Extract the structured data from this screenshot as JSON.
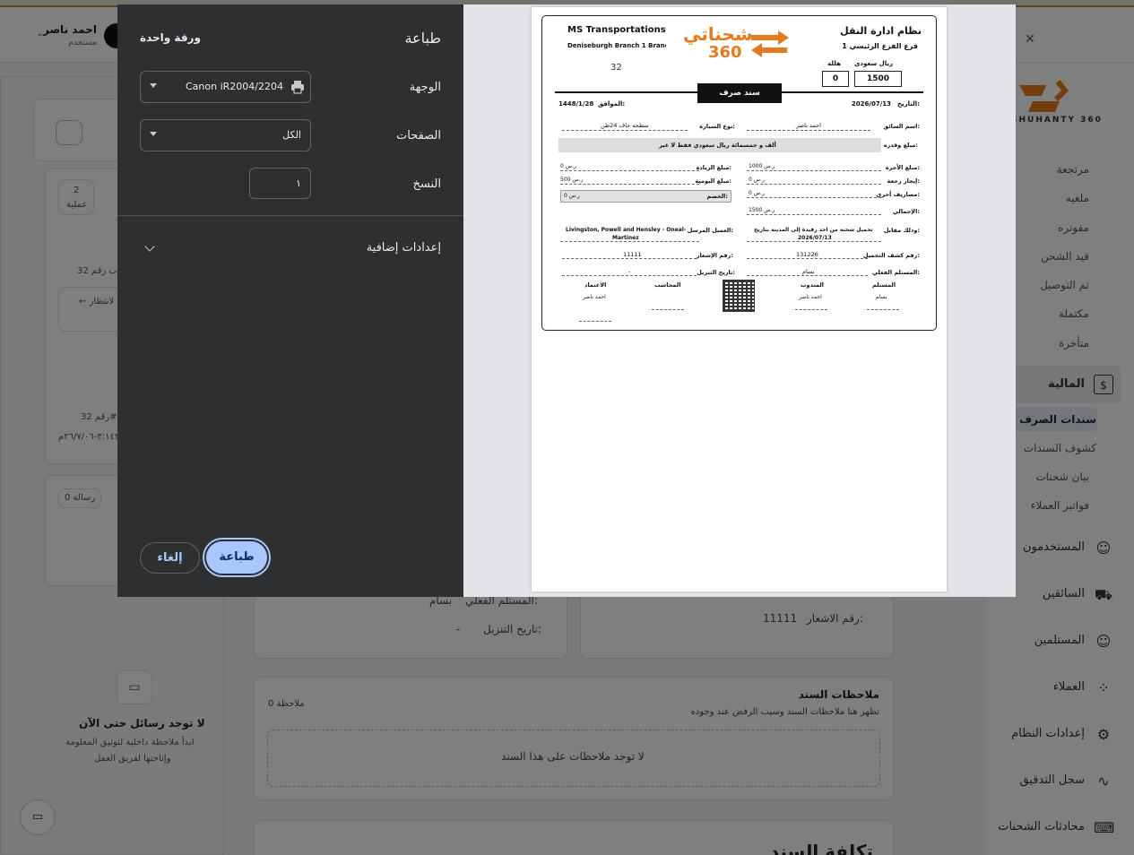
{
  "background": {
    "user": {
      "name": "احمد ناصر",
      "role": "مستخدم"
    },
    "sidebar": {
      "sub_items": [
        "مرتجعة",
        "ملغيه",
        "مفوتره",
        "قيد الشحن",
        "تم التوصيل",
        "مكتملة",
        "متأخرة"
      ],
      "finance_label": "المالية",
      "finance_sub": [
        "سندات الصرف",
        "كشوف السندات",
        "بيان شحنات",
        "فواتير العملاء"
      ],
      "main_items": [
        "المستخدمون",
        "السائقين",
        "المستلمين",
        "العملاء",
        "إعدادات النظام",
        "سجل التدقيق",
        "محادثات الشحنات"
      ],
      "logo_text": "SHUHANTY 360"
    },
    "left": {
      "count_value": "2",
      "count_label": "عملية",
      "doc_ref_1": "ب رقم 32#",
      "waiting": "← لانتظار",
      "doc_ref_2": "رقم 32#",
      "doc_date": "٣:١٤٢٨-٢٦/٧/٠٦م",
      "messages_badge": "0 رسالة",
      "no_messages_title": "لا توجد رسائل حتى الآن",
      "no_messages_desc_1": "ابدأ ملاحظة داخلية لتوثيق المعلومة",
      "no_messages_desc_2": "وإتاحتها لفريق العمل"
    },
    "main": {
      "actual_receiver_label": "المستلم الفعلي:",
      "actual_receiver_value": "بسام",
      "unload_date_label": "تاريخ التنزيل:",
      "unload_date_value": "-",
      "notice_label": "رقم الاشعار:",
      "notice_value": "11111",
      "notes_title": "ملاحظات السند",
      "notes_desc": "تظهر هنا ملاحظات السند وسبب الرفض عند وجوده",
      "notes_count": "0 ملاحظة",
      "no_notes": "لا توجد ملاحظات على هذا السند",
      "cost_title": "تكلفة السند"
    }
  },
  "dialog": {
    "title": "طباعة",
    "sheets": "ورقة واحدة",
    "destination_label": "الوجهة",
    "destination_value": "Canon iR2004/2204",
    "pages_label": "الصفحات",
    "pages_value": "الكل",
    "copies_label": "النسخ",
    "copies_value": "١",
    "more_settings": "إعدادات إضافية",
    "print_button": "طباعة",
    "cancel_button": "إلغاء"
  },
  "receipt": {
    "company_en": "MS Transportations",
    "branch_en": "Deniseburgh Branch 1 Branch",
    "doc_number": "32",
    "logo_text": "شحناتي",
    "logo_num": "360",
    "company_ar": "نظام ادارة النقل",
    "branch_ar": "فرع الفرع الرئيسي 1",
    "riyal_label": "ريال سعودي",
    "halala_label": "هللة",
    "riyal_value": "1500",
    "halala_value": "0",
    "voucher_title": "سند صرف",
    "date_label": "التاريخ:",
    "date_value": "2026/07/13",
    "hijri_label": "الموافق:",
    "hijri_value": "1448/1/28",
    "driver_label": "اسم السائق:",
    "driver_value": "احمد ناصر",
    "car_type_label": "نوع السيارة:",
    "car_type_value": "سطحه جاف 24طن",
    "amount_words_label": "مبلغ وقدره:",
    "amount_words_value": "ألف و خمسمائة ريال سعودي فقط لا غير",
    "fare_label": "مبلغ الأجرة:",
    "fare_value": "1000 ر.س",
    "return_rent_label": "إيجار رجعة:",
    "return_rent_value": "0 ر.س",
    "other_exp_label": "مصاريف أخرى:",
    "other_exp_value": "0 ر.س",
    "total_label": "الإجمالي:",
    "total_value": "1500 ر.س",
    "increase_label": "مبلغ الزيادة:",
    "increase_value": "0 ر.س",
    "daily_label": "مبلغ اليومية:",
    "daily_value": "500 ر.س",
    "discount_label": "الخصم:",
    "discount_value": "0 ر.س",
    "in_exchange_label": "وذلك مقابل:",
    "in_exchange_value_1": "تحميل شحنة من احد رفيدة إلى المدينة بتاريخ",
    "in_exchange_value_2": "2026/07/13",
    "sender_label": "العميل المرسل:",
    "sender_value_1": "Livingston, Powell and Hensley - Oneal-",
    "sender_value_2": "Martinez",
    "manifest_label": "رقم كشف التحميل:",
    "manifest_value": "131226",
    "notice_label": "رقم الإشعار:",
    "notice_value": "11111",
    "actual_receiver_label": "المستلم الفعلي:",
    "actual_receiver_value": "بسام",
    "unload_label": "تاريخ التنزيل:",
    "unload_value": "-",
    "sig_receiver": "المستلم",
    "sig_receiver_name": "بسام",
    "sig_rep": "المندوب",
    "sig_rep_name": "احمد ناصر",
    "sig_accountant": "المحاسب",
    "sig_approval": "الاعتماد",
    "sig_approval_name": "احمد ناصر"
  }
}
